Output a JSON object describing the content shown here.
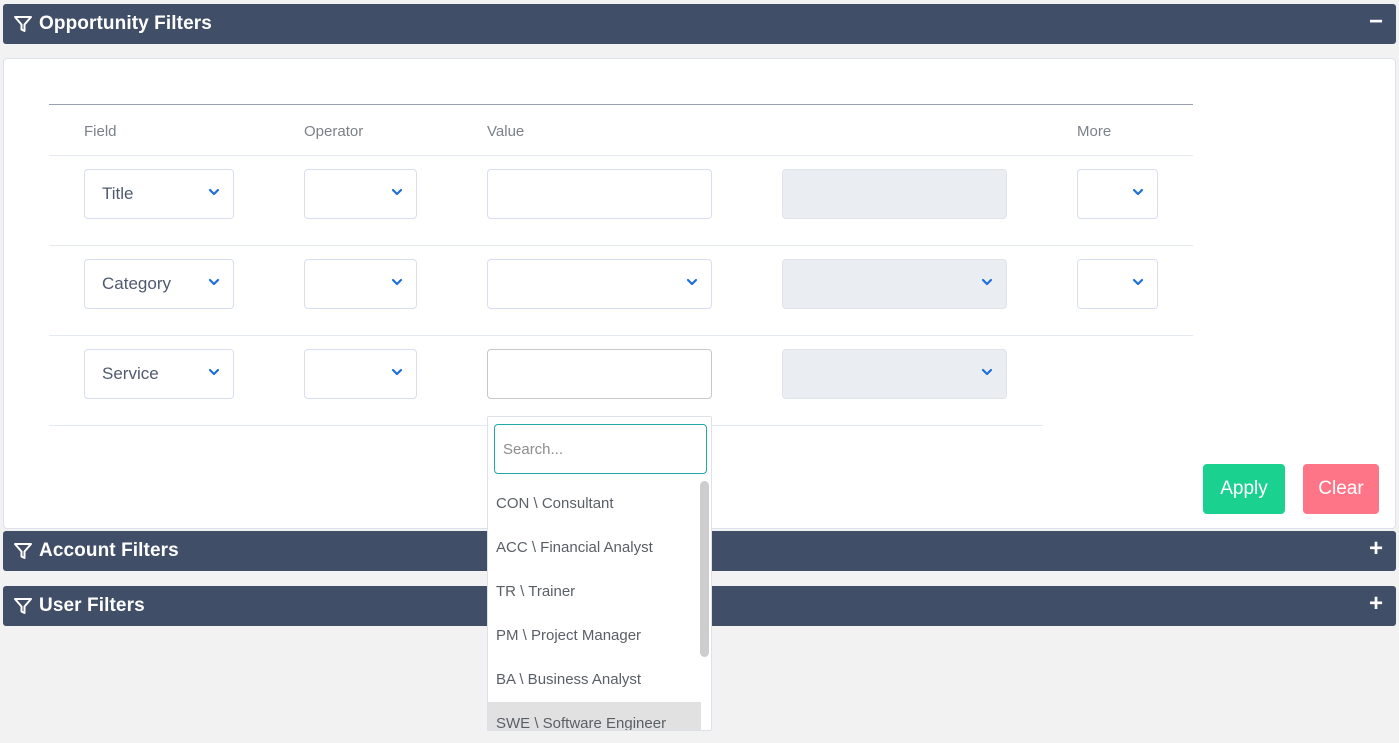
{
  "panels": {
    "opportunity": {
      "title": "Opportunity Filters",
      "toggle": "−",
      "icon": "funnel-icon",
      "state": "expanded"
    },
    "account": {
      "title": "Account Filters",
      "toggle": "+",
      "icon": "funnel-icon",
      "state": "collapsed"
    },
    "user": {
      "title": "User Filters",
      "toggle": "+",
      "icon": "funnel-icon",
      "state": "collapsed"
    }
  },
  "table": {
    "headers": {
      "field": "Field",
      "operator": "Operator",
      "value": "Value",
      "extra": "",
      "more": "More"
    },
    "rows": [
      {
        "field": "Title",
        "operator": "",
        "value": "",
        "extra": "",
        "more": ""
      },
      {
        "field": "Category",
        "operator": "",
        "value": "",
        "extra": "",
        "more": ""
      },
      {
        "field": "Service",
        "operator": "",
        "value": "",
        "extra": ""
      }
    ]
  },
  "dropdown": {
    "search_placeholder": "Search...",
    "search_value": "",
    "options": [
      "CON \\ Consultant",
      "ACC \\ Financial Analyst",
      "TR \\ Trainer",
      "PM \\ Project Manager",
      "BA \\ Business Analyst",
      "SWE \\ Software Engineer"
    ],
    "highlighted_index": 5
  },
  "buttons": {
    "apply": "Apply",
    "clear": "Clear"
  },
  "colors": {
    "header_bg": "#404e67",
    "apply": "#1bd190",
    "clear": "#ff7588",
    "chevron": "#1e6fd9",
    "search_focus": "#1fa8a6"
  }
}
